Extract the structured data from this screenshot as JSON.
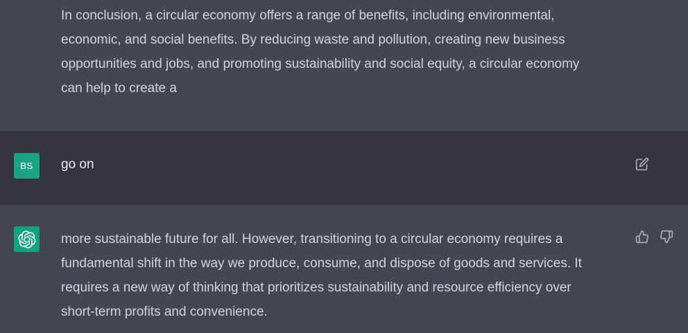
{
  "conversation": {
    "messages": [
      {
        "role": "assistant",
        "lines": [
          "In conclusion, a circular economy offers a range of benefits, including environmental,",
          "economic, and social benefits. By reducing waste and pollution, creating new business",
          "opportunities and jobs, and promoting sustainability and social equity, a circular economy",
          "can help to create a"
        ]
      },
      {
        "role": "user",
        "avatar_initials": "BS",
        "avatar_color": "#1aa385",
        "text": "go on",
        "action_icon": "edit-icon"
      },
      {
        "role": "assistant",
        "avatar_icon": "openai-logo-icon",
        "avatar_color": "#10a37f",
        "lines": [
          "more sustainable future for all. However, transitioning to a circular economy requires a",
          "fundamental shift in the way we produce, consume, and dispose of goods and services. It",
          "requires a new way of thinking that prioritizes sustainability and resource efficiency over",
          "short-term profits and convenience."
        ],
        "action_icons": [
          "thumbs-up-icon",
          "thumbs-down-icon"
        ]
      }
    ]
  },
  "theme": {
    "assistant_bg": "#444654",
    "user_bg": "#343541",
    "text_color": "#d1d5db",
    "icon_color": "#acacbe"
  }
}
